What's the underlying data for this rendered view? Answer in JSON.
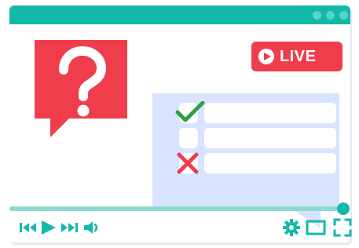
{
  "live_badge": {
    "label": "LIVE"
  },
  "icons": {
    "question": "question-mark-icon",
    "check": "check-icon",
    "cross": "x-icon",
    "rewind": "rewind-icon",
    "play": "play-icon",
    "fast_forward": "fast-forward-icon",
    "volume": "volume-icon",
    "settings": "gear-icon",
    "theater": "theater-mode-icon",
    "fullscreen": "fullscreen-icon"
  },
  "colors": {
    "accent": "#14b8a9",
    "accent_light": "#8fd9d0",
    "red": "#ef3d4b",
    "quiz_panel": "#d8e4ff",
    "check_green": "#2f9e44"
  }
}
